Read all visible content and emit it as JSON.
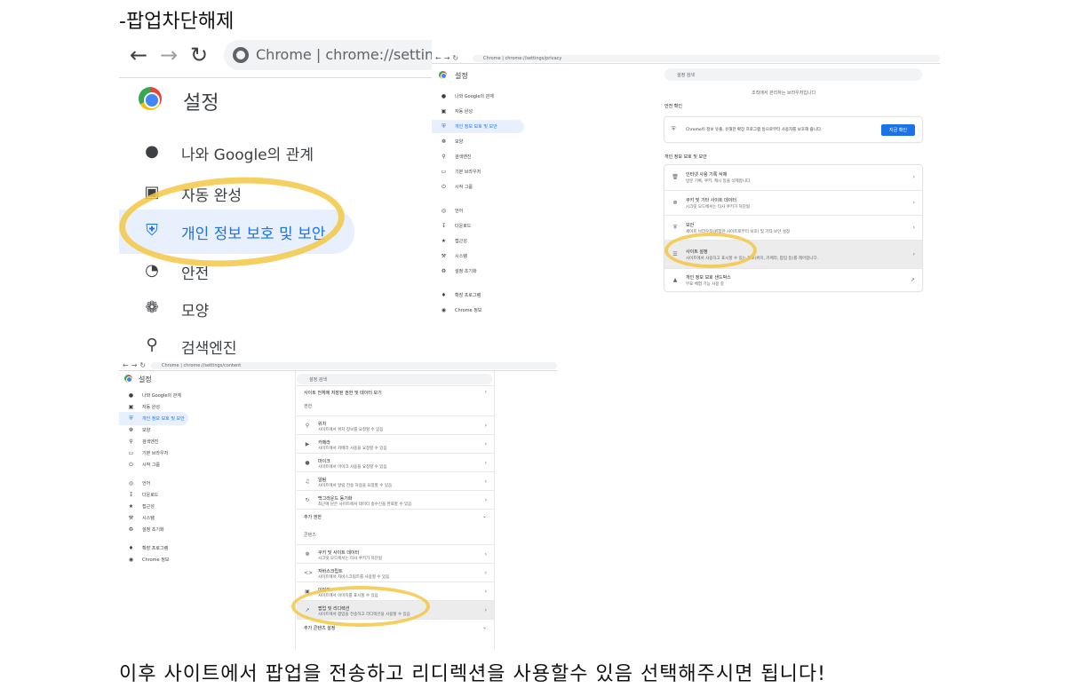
{
  "title": "-팝업차단해제",
  "footer": "이후 사이트에서 팝업을 전송하고 리디렉션을 사용할수 있음 선택해주시면 됩니다!",
  "big": {
    "omnibox": "Chrome  |  chrome://settings/",
    "settings_title": "설정",
    "items": [
      {
        "label": "나와 Google의 관계",
        "icon": "person-icon"
      },
      {
        "label": "자동 완성",
        "icon": "clipboard-icon"
      },
      {
        "label": "개인 정보 보호 및 보안",
        "icon": "shield-icon"
      },
      {
        "label": "안전",
        "icon": "gauge-icon"
      },
      {
        "label": "모양",
        "icon": "palette-icon"
      },
      {
        "label": "검색엔진",
        "icon": "search-icon"
      }
    ]
  },
  "shot1": {
    "url": "Chrome  |  chrome://settings/privacy",
    "settings_title": "설정",
    "search_placeholder": "설정 검색",
    "org_notice": "조직에서 관리하는 브라우저입니다",
    "sidebar": [
      "나와 Google의 관계",
      "자동 완성",
      "개인 정보 보호 및 보안",
      "모양",
      "검색엔진",
      "기본 브라우저",
      "시작 그룹",
      "언어",
      "다운로드",
      "접근성",
      "시스템",
      "설정 초기화",
      "확장 프로그램",
      "Chrome 정보"
    ],
    "safety_check_title": "안전 확인",
    "safety_check_text": "Chrome이 정보 유출, 유해한 확장 프로그램 등으로부터 사용자를 보호해 줍니다.",
    "safety_check_button": "지금 확인",
    "privacy_title": "개인 정보 보호 및 보안",
    "rows": [
      {
        "t1": "인터넷 사용 기록 삭제",
        "t2": "방문 기록, 쿠키, 캐시 등을 삭제합니다."
      },
      {
        "t1": "쿠키 및 기타 사이트 데이터",
        "t2": "시크릿 모드에서는 타사 쿠키가 차단됨"
      },
      {
        "t1": "보안",
        "t2": "세이프 브라우징(위험한 사이트로부터 보호) 및 기타 보안 설정"
      },
      {
        "t1": "사이트 설정",
        "t2": "사이트에서 사용하고 표시할 수 있는 정보(위치, 카메라, 팝업 등)를 제어합니다."
      },
      {
        "t1": "개인 정보 보호 샌드박스",
        "t2": "무료 체험 기능 사용 중"
      }
    ]
  },
  "shot2": {
    "url": "Chrome  |  chrome://settings/content",
    "settings_title": "설정",
    "search_placeholder": "설정 검색",
    "sidebar": [
      "나와 Google의 관계",
      "자동 완성",
      "개인 정보 보호 및 보안",
      "모양",
      "검색엔진",
      "기본 브라우저",
      "시작 그룹",
      "언어",
      "다운로드",
      "접근성",
      "시스템",
      "설정 초기화",
      "확장 프로그램",
      "Chrome 정보"
    ],
    "top_row": "사이트 전체에 저장된 권한 및 데이터 보기",
    "perm_title": "권한",
    "perm_rows": [
      {
        "t1": "위치",
        "t2": "사이트에서 위치 정보를 요청할 수 있음"
      },
      {
        "t1": "카메라",
        "t2": "사이트에서 카메라 사용을 요청할 수 있음"
      },
      {
        "t1": "마이크",
        "t2": "사이트에서 마이크 사용을 요청할 수 있음"
      },
      {
        "t1": "알림",
        "t2": "사이트에서 알림 전송 허용을 요청할 수 있음"
      },
      {
        "t1": "백그라운드 동기화",
        "t2": "최근에 닫은 사이트에서 데이터 송수신을 완료할 수 있음"
      }
    ],
    "more_perm": "추가 권한",
    "content_title": "콘텐츠",
    "content_rows": [
      {
        "t1": "쿠키 및 사이트 데이터",
        "t2": "시크릿 모드에서는 타사 쿠키가 차단됨"
      },
      {
        "t1": "자바스크립트",
        "t2": "사이트에서 자바스크립트를 사용할 수 있음"
      },
      {
        "t1": "이미지",
        "t2": "사이트에서 이미지를 표시할 수 있음"
      },
      {
        "t1": "팝업 및 리디렉션",
        "t2": "사이트에서 팝업을 전송하고 리디렉션을 사용할 수 있음"
      },
      {
        "t1": "추가 콘텐츠 설정",
        "t2": ""
      }
    ]
  },
  "colors": {
    "accent": "#1a73e8",
    "marker": "#f3c844",
    "active_bg": "#e8f0fe"
  }
}
